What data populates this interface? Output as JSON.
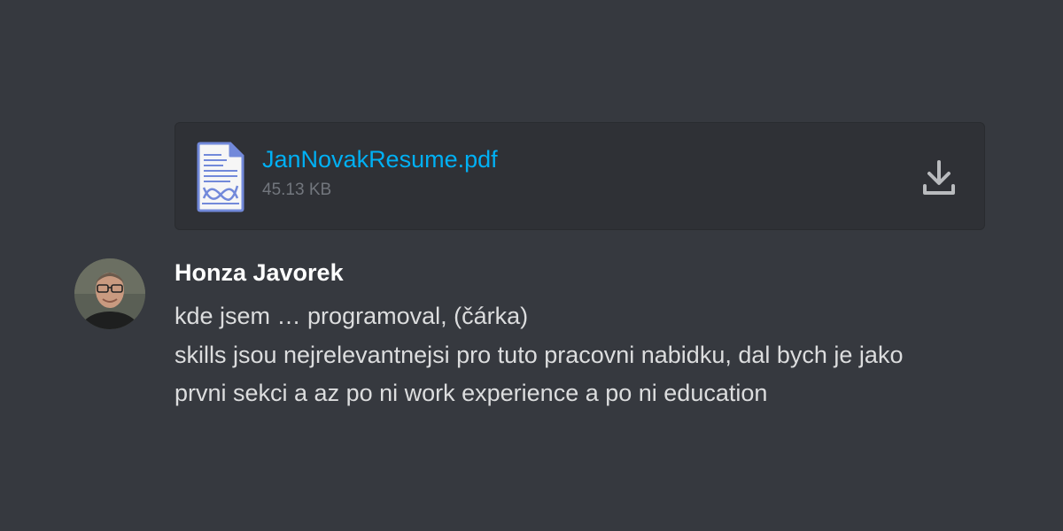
{
  "attachment": {
    "file_name": "JanNovakResume.pdf",
    "file_size": "45.13 KB",
    "file_icon": "pdf-document-icon",
    "download_icon": "download-icon"
  },
  "message": {
    "author": "Honza Javorek",
    "avatar_icon": "user-avatar",
    "lines": [
      "kde jsem … programoval, (čárka)",
      "skills jsou nejrelevantnejsi pro tuto pracovni nabidku, dal bych je jako",
      "prvni sekci a az po ni work experience a po ni education"
    ]
  },
  "colors": {
    "background": "#36393f",
    "attachment_bg": "#2f3136",
    "link": "#00b0f4",
    "muted": "#72767d",
    "author": "#ffffff",
    "text": "#dcddde",
    "icon_accent": "#7289da"
  }
}
